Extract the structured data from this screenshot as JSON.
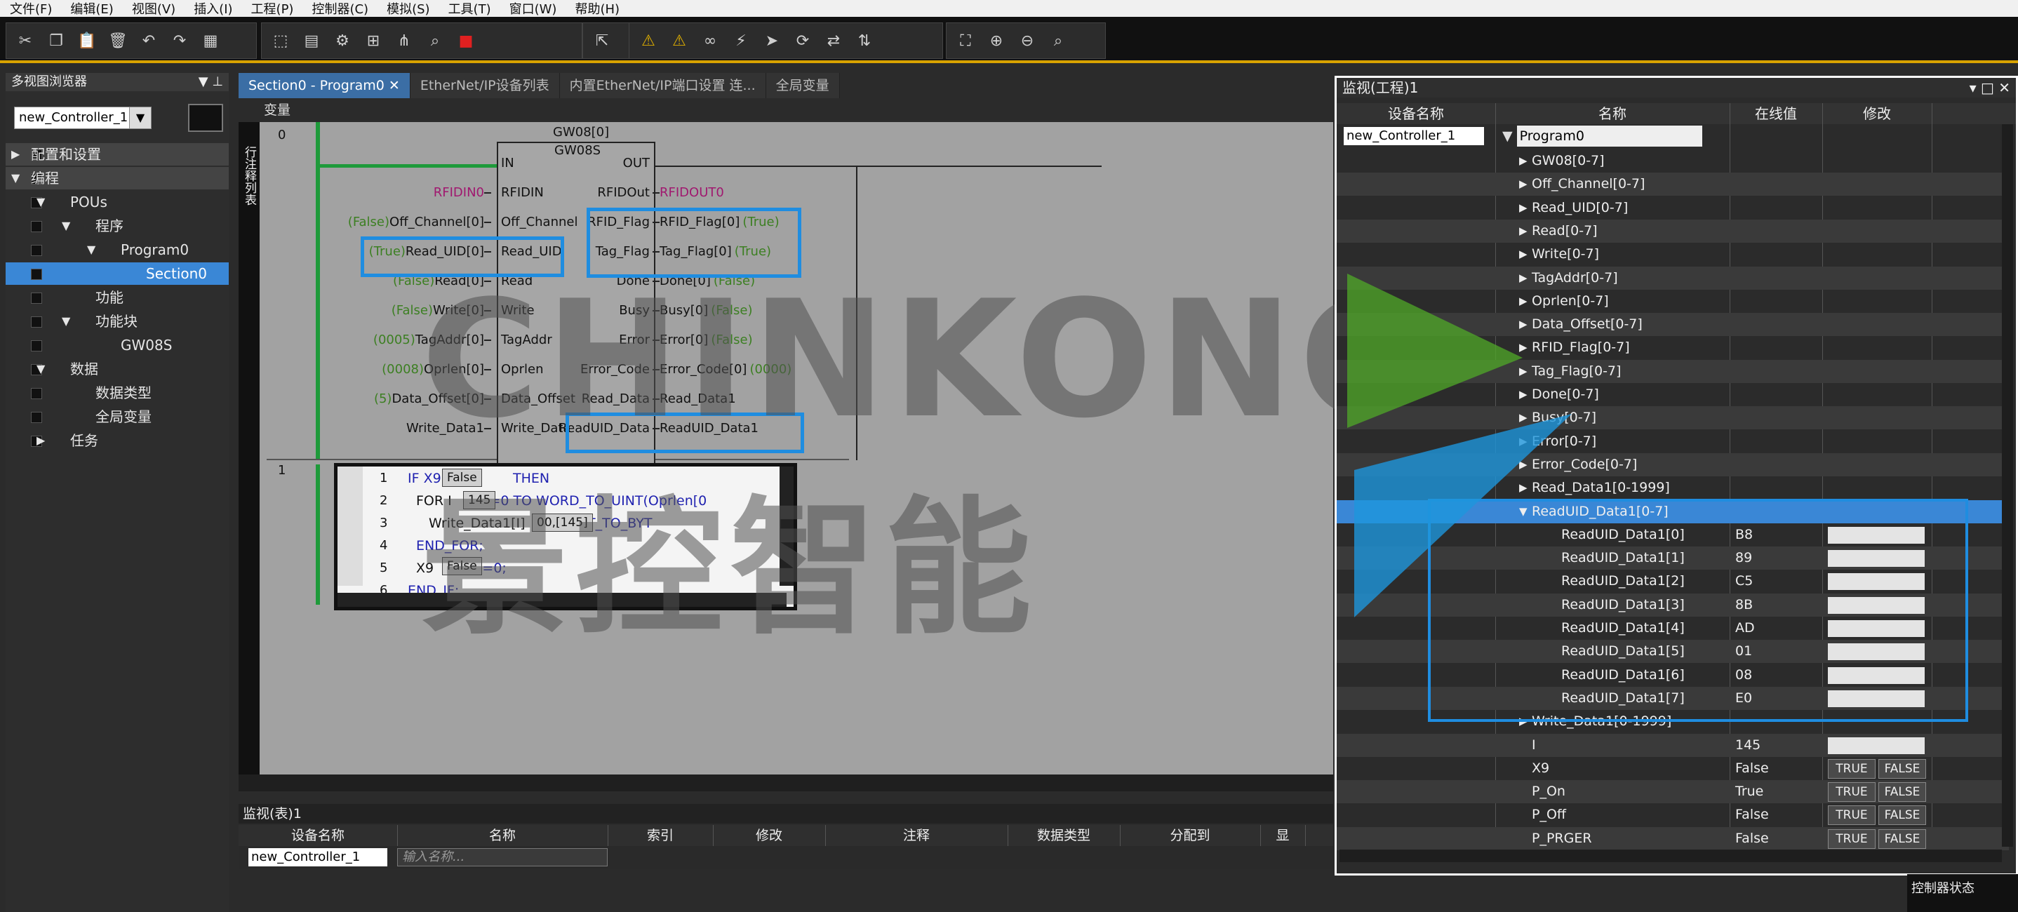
{
  "menu": [
    "文件(F)",
    "编辑(E)",
    "视图(V)",
    "插入(I)",
    "工程(P)",
    "控制器(C)",
    "模拟(S)",
    "工具(T)",
    "窗口(W)",
    "帮助(H)"
  ],
  "left_panel": {
    "title": "多视图浏览器",
    "pin": "▼ ⊥",
    "controller": "new_Controller_1",
    "tree": [
      {
        "label": "配置和设置",
        "indent": 0,
        "arrow": "▶",
        "style": "hl"
      },
      {
        "label": "编程",
        "indent": 0,
        "arrow": "▼",
        "style": "hl"
      },
      {
        "label": "POUs",
        "indent": 1,
        "arrow": "▼",
        "style": ""
      },
      {
        "label": "程序",
        "indent": 2,
        "arrow": "▼",
        "style": ""
      },
      {
        "label": "Program0",
        "indent": 3,
        "arrow": "▼",
        "style": ""
      },
      {
        "label": "Section0",
        "indent": 4,
        "arrow": "",
        "style": "sel"
      },
      {
        "label": "功能",
        "indent": 2,
        "arrow": "",
        "style": ""
      },
      {
        "label": "功能块",
        "indent": 2,
        "arrow": "▼",
        "style": ""
      },
      {
        "label": "GW08S",
        "indent": 3,
        "arrow": "",
        "style": ""
      },
      {
        "label": "数据",
        "indent": 1,
        "arrow": "▼",
        "style": ""
      },
      {
        "label": "数据类型",
        "indent": 2,
        "arrow": "",
        "style": ""
      },
      {
        "label": "全局变量",
        "indent": 2,
        "arrow": "",
        "style": ""
      },
      {
        "label": "任务",
        "indent": 1,
        "arrow": "▶",
        "style": ""
      }
    ]
  },
  "tabs": [
    "Section0 - Program0 ✕",
    "EtherNet/IP设备列表",
    "内置EtherNet/IP端口设置 连...",
    "全局变量"
  ],
  "editor": {
    "var_label": "变量",
    "side_label": "行注释列表",
    "rung0": "0",
    "rung1": "1",
    "fb_instance": "GW08[0]",
    "fb_type": "GW08S",
    "in_pins": [
      "IN",
      "RFIDIN",
      "Off_Channel",
      "Read_UID",
      "Read",
      "Write",
      "TagAddr",
      "Oprlen",
      "Data_Offset",
      "Write_Data"
    ],
    "out_pins": [
      "OUT",
      "RFIDOut",
      "RFID_Flag",
      "Tag_Flag",
      "Done",
      "Busy",
      "Error",
      "Error_Code",
      "Read_Data",
      "ReadUID_Data"
    ],
    "in_vars": [
      {
        "pre": "",
        "name": "",
        "kind": ""
      },
      {
        "pre": "",
        "name": "RFIDIN0",
        "kind": "mag"
      },
      {
        "pre": "(False)",
        "name": "Off_Channel[0]",
        "kind": ""
      },
      {
        "pre": "(True)",
        "name": "Read_UID[0]",
        "kind": ""
      },
      {
        "pre": "(False)",
        "name": "Read[0]",
        "kind": ""
      },
      {
        "pre": "(False)",
        "name": "Write[0]",
        "kind": ""
      },
      {
        "pre": "(0005)",
        "name": "TagAddr[0]",
        "kind": ""
      },
      {
        "pre": "(0008)",
        "name": "Oprlen[0]",
        "kind": ""
      },
      {
        "pre": "(5)",
        "name": "Data_Offset[0]",
        "kind": ""
      },
      {
        "pre": "",
        "name": "Write_Data1",
        "kind": ""
      }
    ],
    "out_vars": [
      {
        "name": "",
        "post": ""
      },
      {
        "name": "RFIDOUT0",
        "post": ""
      },
      {
        "name": "RFID_Flag[0]",
        "post": "(True)"
      },
      {
        "name": "Tag_Flag[0]",
        "post": "(True)"
      },
      {
        "name": "Done[0]",
        "post": "(False)"
      },
      {
        "name": "Busy[0]",
        "post": "(False)"
      },
      {
        "name": "Error[0]",
        "post": "(False)"
      },
      {
        "name": "Error_Code[0]",
        "post": "(0000)"
      },
      {
        "name": "Read_Data1",
        "post": ""
      },
      {
        "name": "ReadUID_Data1",
        "post": ""
      }
    ],
    "st_lines": [
      {
        "no": "1",
        "code": "IF X9",
        "tail": "THEN"
      },
      {
        "no": "2",
        "code": "FOR I",
        "tail": ":=0 TO WORD_TO_UINT(Oprlen[0"
      },
      {
        "no": "3",
        "code": "Write_Data1[I]",
        "tail": ":=UINT_TO_BYT"
      },
      {
        "no": "4",
        "code": "END_FOR;",
        "tail": ""
      },
      {
        "no": "5",
        "code": "X9",
        "tail": ":=0;"
      },
      {
        "no": "6",
        "code": "END_IF;",
        "tail": ""
      }
    ],
    "st_pops": [
      "False",
      "145",
      "00,[145]",
      "False"
    ]
  },
  "bottom_watch": {
    "title": "监视(表)1",
    "headers": [
      "设备名称",
      "名称",
      "索引",
      "修改",
      "注释",
      "数据类型",
      "分配到",
      "显"
    ],
    "device": "new_Controller_1",
    "name_placeholder": "输入名称..."
  },
  "right_watch": {
    "title": "监视(工程)1",
    "headers": [
      "设备名称",
      "名称",
      "在线值",
      "修改"
    ],
    "device": "new_Controller_1",
    "root": "Program0",
    "rows": [
      {
        "name": "GW08[0-7]",
        "arrow": "▶",
        "level": 1,
        "value": "",
        "mod": ""
      },
      {
        "name": "Off_Channel[0-7]",
        "arrow": "▶",
        "level": 1,
        "value": "",
        "mod": ""
      },
      {
        "name": "Read_UID[0-7]",
        "arrow": "▶",
        "level": 1,
        "value": "",
        "mod": ""
      },
      {
        "name": "Read[0-7]",
        "arrow": "▶",
        "level": 1,
        "value": "",
        "mod": ""
      },
      {
        "name": "Write[0-7]",
        "arrow": "▶",
        "level": 1,
        "value": "",
        "mod": ""
      },
      {
        "name": "TagAddr[0-7]",
        "arrow": "▶",
        "level": 1,
        "value": "",
        "mod": ""
      },
      {
        "name": "Oprlen[0-7]",
        "arrow": "▶",
        "level": 1,
        "value": "",
        "mod": ""
      },
      {
        "name": "Data_Offset[0-7]",
        "arrow": "▶",
        "level": 1,
        "value": "",
        "mod": ""
      },
      {
        "name": "RFID_Flag[0-7]",
        "arrow": "▶",
        "level": 1,
        "value": "",
        "mod": ""
      },
      {
        "name": "Tag_Flag[0-7]",
        "arrow": "▶",
        "level": 1,
        "value": "",
        "mod": ""
      },
      {
        "name": "Done[0-7]",
        "arrow": "▶",
        "level": 1,
        "value": "",
        "mod": ""
      },
      {
        "name": "Busy[0-7]",
        "arrow": "▶",
        "level": 1,
        "value": "",
        "mod": ""
      },
      {
        "name": "Error[0-7]",
        "arrow": "▶",
        "level": 1,
        "value": "",
        "mod": ""
      },
      {
        "name": "Error_Code[0-7]",
        "arrow": "▶",
        "level": 1,
        "value": "",
        "mod": ""
      },
      {
        "name": "Read_Data1[0-1999]",
        "arrow": "▶",
        "level": 1,
        "value": "",
        "mod": ""
      },
      {
        "name": "ReadUID_Data1[0-7]",
        "arrow": "▼",
        "level": 1,
        "value": "",
        "mod": "",
        "sel": true
      },
      {
        "name": "ReadUID_Data1[0]",
        "arrow": "",
        "level": 2,
        "value": "B8",
        "mod": "input"
      },
      {
        "name": "ReadUID_Data1[1]",
        "arrow": "",
        "level": 2,
        "value": "89",
        "mod": "input"
      },
      {
        "name": "ReadUID_Data1[2]",
        "arrow": "",
        "level": 2,
        "value": "C5",
        "mod": "input"
      },
      {
        "name": "ReadUID_Data1[3]",
        "arrow": "",
        "level": 2,
        "value": "8B",
        "mod": "input"
      },
      {
        "name": "ReadUID_Data1[4]",
        "arrow": "",
        "level": 2,
        "value": "AD",
        "mod": "input"
      },
      {
        "name": "ReadUID_Data1[5]",
        "arrow": "",
        "level": 2,
        "value": "01",
        "mod": "input"
      },
      {
        "name": "ReadUID_Data1[6]",
        "arrow": "",
        "level": 2,
        "value": "08",
        "mod": "input"
      },
      {
        "name": "ReadUID_Data1[7]",
        "arrow": "",
        "level": 2,
        "value": "E0",
        "mod": "input"
      },
      {
        "name": "Write_Data1[0-1999]",
        "arrow": "▶",
        "level": 1,
        "value": "",
        "mod": ""
      },
      {
        "name": "I",
        "arrow": "",
        "level": 1,
        "value": "145",
        "mod": "input"
      },
      {
        "name": "X9",
        "arrow": "",
        "level": 1,
        "value": "False",
        "mod": "bool"
      },
      {
        "name": "P_On",
        "arrow": "",
        "level": 1,
        "value": "True",
        "mod": "bool"
      },
      {
        "name": "P_Off",
        "arrow": "",
        "level": 1,
        "value": "False",
        "mod": "bool"
      },
      {
        "name": "P_PRGER",
        "arrow": "",
        "level": 1,
        "value": "False",
        "mod": "bool"
      }
    ],
    "true_label": "TRUE",
    "false_label": "FALSE"
  },
  "watermark": {
    "latin": "CHINKONG",
    "cn": "景控智能"
  },
  "status": {
    "controller_status": "控制器状态"
  },
  "colors": {
    "accent_blue": "#1f8de0",
    "selection": "#3a87d6",
    "toolbar_accent": "#d9a300",
    "rung_green": "#1e9a3a"
  }
}
